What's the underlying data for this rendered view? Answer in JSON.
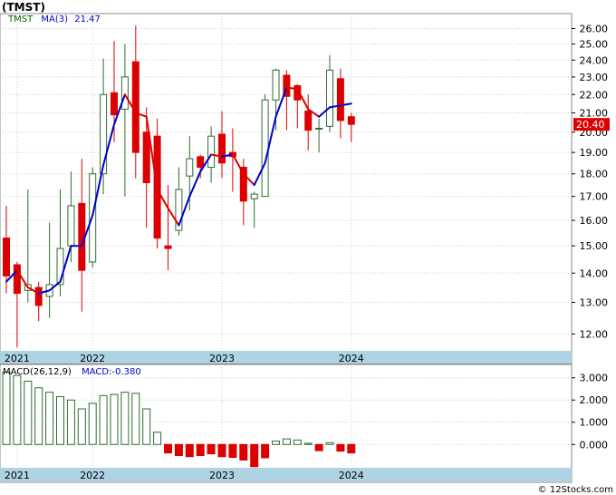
{
  "header": {
    "title": "(TMST)"
  },
  "credit": "© 12Stocks.com",
  "colors": {
    "up": "#2f6b2f",
    "down": "#dd0000",
    "ma_up": "#0000cc",
    "ma_down": "#dd0000",
    "grid": "#cccccc",
    "axis_band": "#aed3e3",
    "legend_ticker": "#006600",
    "legend_ma": "#0000cc"
  },
  "chart_data": [
    {
      "type": "candlestick",
      "legend": {
        "ticker": "TMST",
        "ma_label": "MA(3)",
        "ma_value": "21.47"
      },
      "last_price": "20.40",
      "y_scale": "log",
      "ylim": [
        11.5,
        27.0
      ],
      "yticks": [
        12,
        13,
        14,
        15,
        16,
        17,
        18,
        19,
        20,
        21,
        22,
        23,
        24,
        25,
        26
      ],
      "ytick_labels": [
        "12.00",
        "13.00",
        "14.00",
        "15.00",
        "16.00",
        "17.00",
        "18.00",
        "19.00",
        "20.00",
        "21.00",
        "22.00",
        "23.00",
        "24.00",
        "25.00",
        "26.00"
      ],
      "xlim": [
        0,
        39
      ],
      "xticks": [
        {
          "at": 1,
          "label": "2021"
        },
        {
          "at": 8,
          "label": "2022"
        },
        {
          "at": 20,
          "label": "2023"
        },
        {
          "at": 32,
          "label": "2024"
        }
      ],
      "grid": true,
      "ohlc": [
        [
          15.3,
          16.6,
          13.3,
          13.9
        ],
        [
          14.3,
          14.4,
          11.6,
          13.3
        ],
        [
          13.4,
          17.3,
          13.0,
          13.6
        ],
        [
          13.5,
          13.7,
          12.4,
          12.9
        ],
        [
          13.2,
          15.9,
          12.5,
          13.6
        ],
        [
          13.6,
          17.3,
          13.2,
          14.9
        ],
        [
          15.0,
          18.1,
          14.4,
          16.6
        ],
        [
          16.7,
          18.7,
          12.7,
          14.1
        ],
        [
          14.4,
          18.3,
          14.2,
          18.0
        ],
        [
          18.0,
          24.1,
          17.1,
          22.0
        ],
        [
          22.1,
          25.2,
          19.5,
          20.9
        ],
        [
          21.2,
          25.0,
          17.0,
          23.0
        ],
        [
          23.9,
          26.2,
          17.8,
          19.0
        ],
        [
          20.0,
          21.3,
          15.7,
          17.6
        ],
        [
          19.8,
          20.7,
          14.9,
          15.3
        ],
        [
          15.0,
          17.5,
          14.1,
          14.9
        ],
        [
          15.6,
          18.3,
          15.4,
          17.3
        ],
        [
          17.9,
          19.8,
          16.4,
          18.7
        ],
        [
          18.8,
          18.9,
          17.8,
          18.3
        ],
        [
          18.3,
          20.3,
          17.6,
          19.8
        ],
        [
          19.9,
          21.1,
          17.8,
          18.5
        ],
        [
          19.0,
          20.2,
          17.2,
          18.8
        ],
        [
          18.3,
          18.7,
          15.8,
          16.8
        ],
        [
          16.9,
          17.2,
          15.7,
          17.1
        ],
        [
          17.0,
          22.0,
          17.0,
          21.7
        ],
        [
          21.7,
          23.5,
          20.1,
          23.4
        ],
        [
          23.1,
          23.4,
          20.1,
          21.9
        ],
        [
          22.5,
          22.6,
          20.2,
          21.7
        ],
        [
          21.1,
          22.0,
          19.1,
          20.1
        ],
        [
          20.2,
          20.7,
          19.0,
          20.2
        ],
        [
          20.3,
          24.3,
          20.0,
          23.4
        ],
        [
          22.9,
          23.5,
          19.7,
          20.6
        ],
        [
          20.8,
          21.0,
          19.5,
          20.4
        ]
      ],
      "ma": [
        13.7,
        14.1,
        13.5,
        13.3,
        13.4,
        13.7,
        15.0,
        15.0,
        16.2,
        18.4,
        20.4,
        22.0,
        21.0,
        20.8,
        17.3,
        16.5,
        15.8,
        17.0,
        18.1,
        18.9,
        18.8,
        18.9,
        18.0,
        17.5,
        18.5,
        20.8,
        22.4,
        22.3,
        21.2,
        20.8,
        21.3,
        21.4,
        21.5
      ]
    },
    {
      "type": "bar",
      "legend": {
        "label": "MACD(26,12,9)",
        "value_label": "MACD:-0.380"
      },
      "ylim": [
        -1.05,
        3.6
      ],
      "yticks": [
        0,
        1,
        2,
        3
      ],
      "ytick_labels": [
        "0.000",
        "1.000",
        "2.000",
        "3.000"
      ],
      "xticks": [
        {
          "at": 1,
          "label": "2021"
        },
        {
          "at": 8,
          "label": "2022"
        },
        {
          "at": 20,
          "label": "2023"
        },
        {
          "at": 32,
          "label": "2024"
        }
      ],
      "values": [
        3.25,
        3.1,
        2.85,
        2.55,
        2.35,
        2.15,
        2.0,
        1.6,
        1.85,
        2.2,
        2.25,
        2.35,
        2.3,
        1.6,
        0.55,
        -0.38,
        -0.5,
        -0.55,
        -0.5,
        -0.42,
        -0.55,
        -0.58,
        -0.7,
        -1.0,
        -0.6,
        0.15,
        0.25,
        0.2,
        0.05,
        -0.28,
        0.08,
        -0.3,
        -0.38
      ]
    }
  ]
}
